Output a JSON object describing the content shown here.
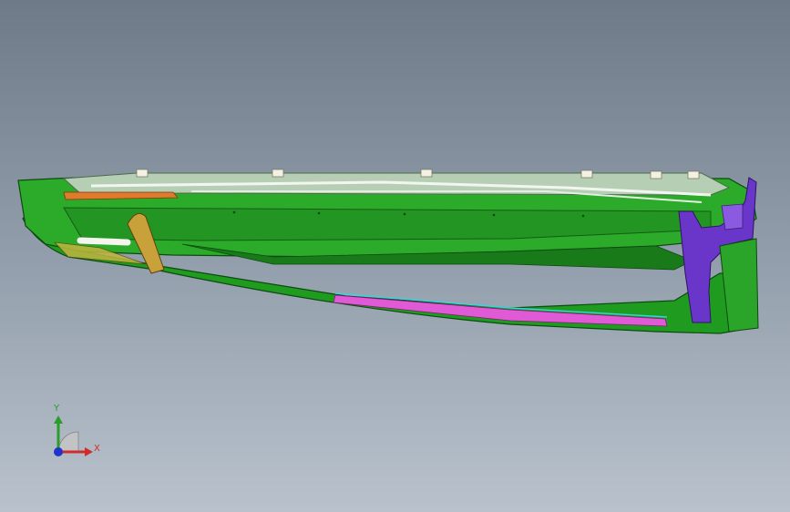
{
  "viewport": {
    "background_top": "#6f7a89",
    "background_bottom": "#b9c2cc"
  },
  "model": {
    "body_color": "#1f9b1f",
    "body_dark": "#0f5e12",
    "accent_purple": "#6a35c9",
    "accent_magenta": "#e05ad6",
    "accent_orange": "#e07a2c",
    "accent_cyan": "#35d6e0",
    "accent_tan": "#c9a13a"
  },
  "triad": {
    "x_label": "X",
    "y_label": "Y",
    "x_color": "#d12c2c",
    "y_color": "#2a9d2a",
    "z_color": "#2233cc"
  }
}
